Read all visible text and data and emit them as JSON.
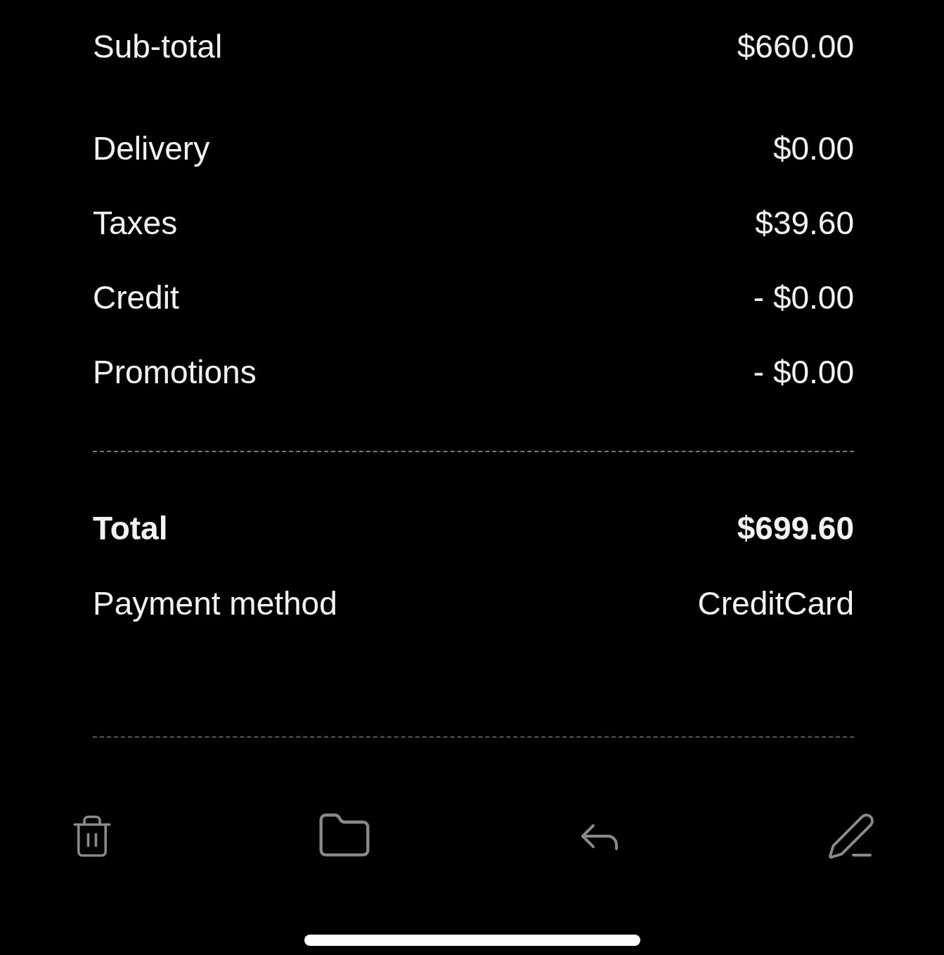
{
  "summary_rows": [
    {
      "label": "Sub-total",
      "value": "$660.00"
    },
    {
      "label": "Delivery",
      "value": "$0.00"
    },
    {
      "label": "Taxes",
      "value": "$39.60"
    },
    {
      "label": "Credit",
      "value": "- $0.00"
    },
    {
      "label": "Promotions",
      "value": "- $0.00"
    }
  ],
  "total": {
    "label": "Total",
    "value": "$699.60"
  },
  "payment": {
    "label": "Payment method",
    "value": "CreditCard"
  }
}
